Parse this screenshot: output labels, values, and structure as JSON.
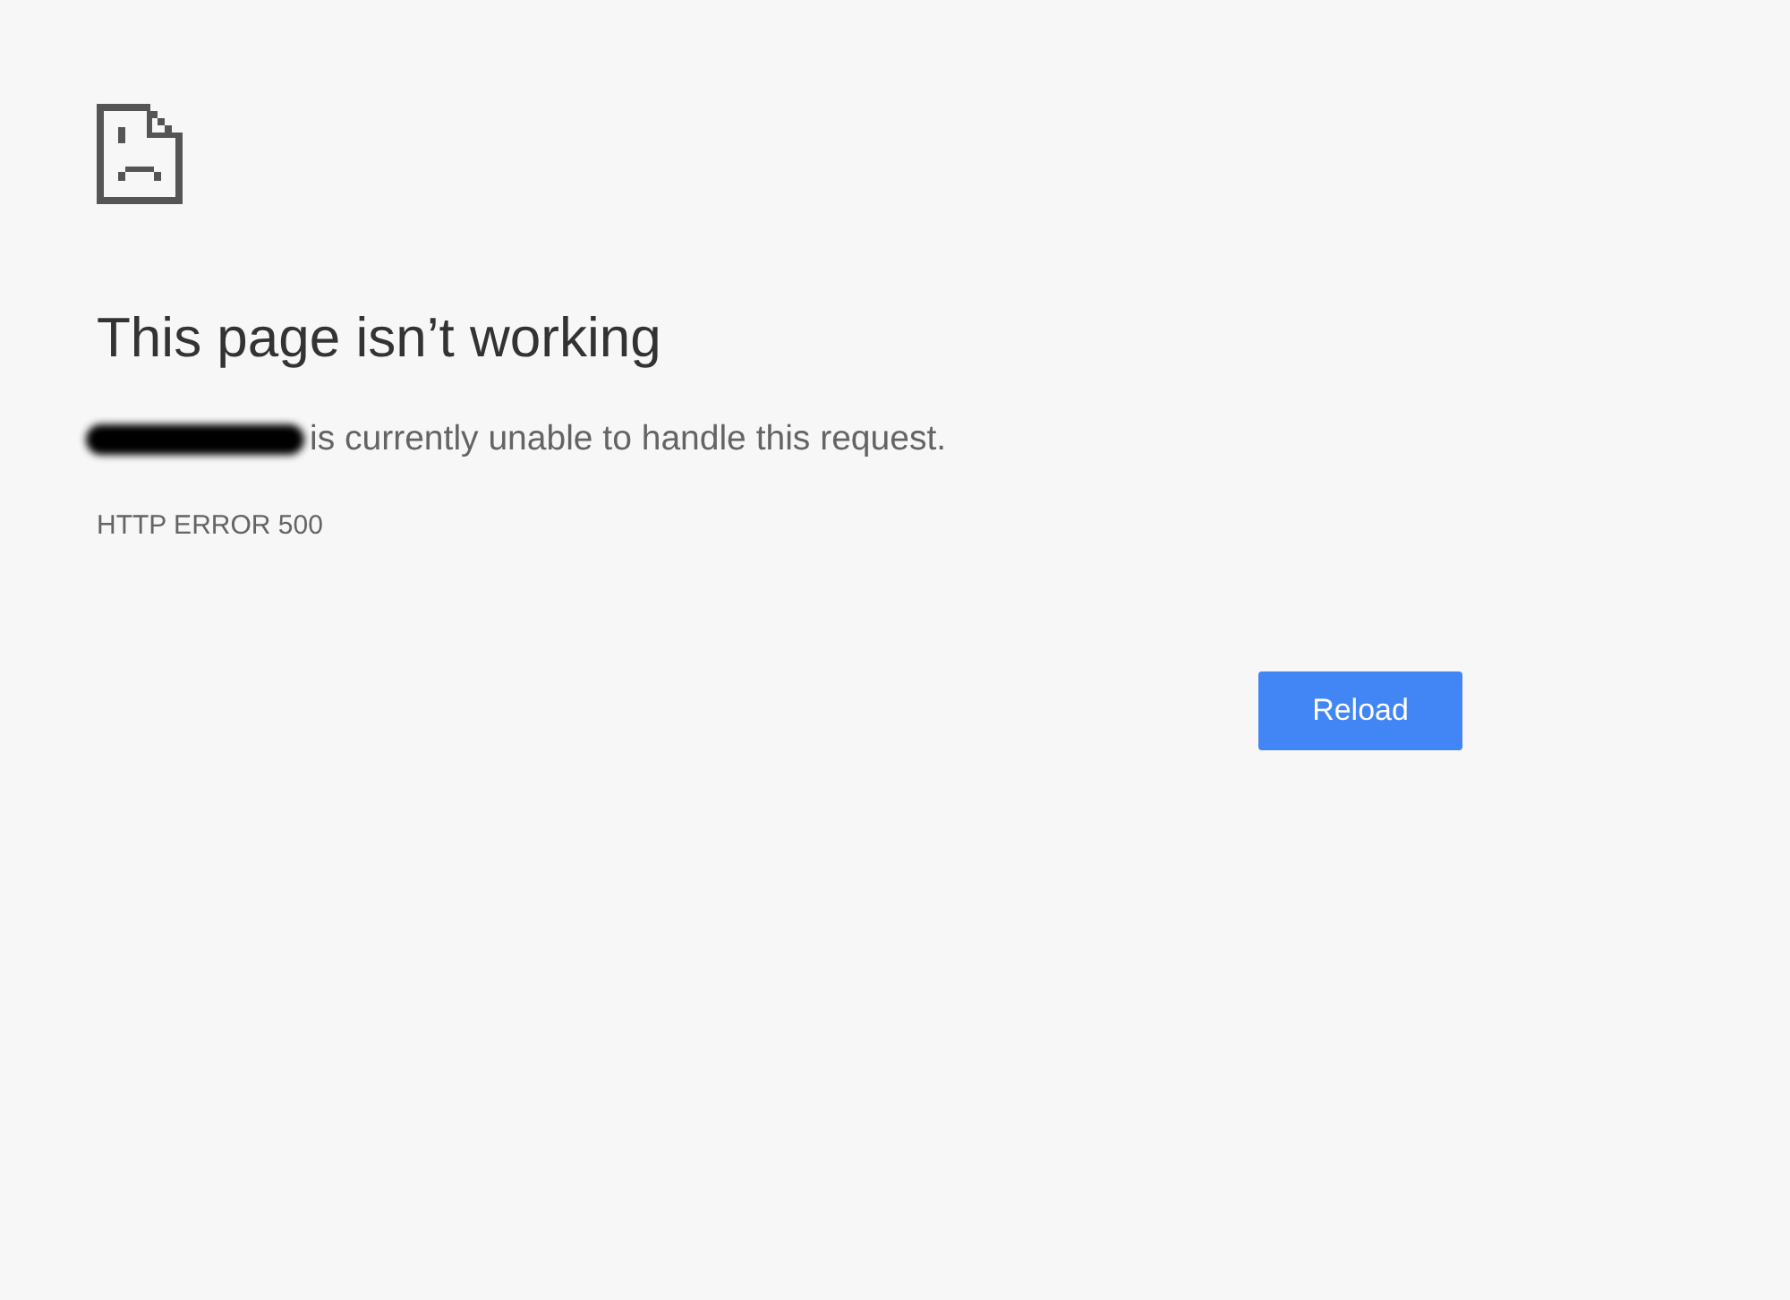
{
  "title": "This page isn’t working",
  "message": {
    "host_redacted": true,
    "text": "is currently unable to handle this request."
  },
  "error_code": "HTTP ERROR 500",
  "buttons": [
    {
      "label": "Reload"
    }
  ]
}
